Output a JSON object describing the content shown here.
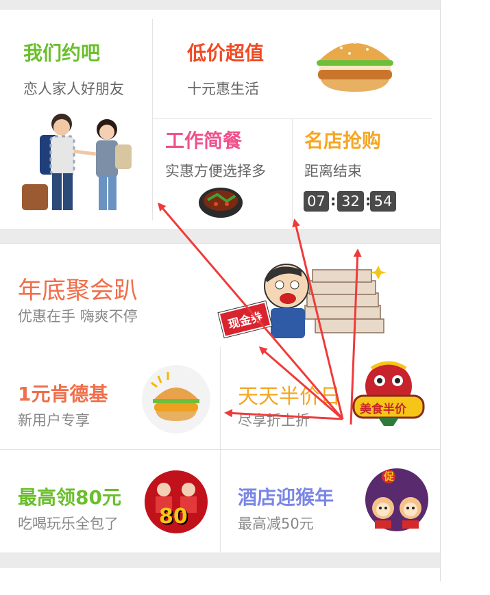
{
  "top": {
    "meet": {
      "title": "我们约吧",
      "subtitle": "恋人家人好朋友"
    },
    "cheap": {
      "title": "低价超值",
      "subtitle": "十元惠生活"
    },
    "lunch": {
      "title": "工作简餐",
      "subtitle": "实惠方便选择多"
    },
    "flash": {
      "title": "名店抢购",
      "subtitle": "距离结束",
      "countdown": [
        "07",
        "32",
        "54"
      ]
    }
  },
  "banner": {
    "title": "年底聚会趴",
    "subtitle": "优惠在手 嗨爽不停",
    "badge": "现金券"
  },
  "grid": [
    {
      "title": "1元肯德基",
      "subtitle": "新用户专享",
      "color": "#f06e4a"
    },
    {
      "title": "天天半价日",
      "subtitle": "尽享折上折",
      "color": "#f5a623",
      "badge": "美食半价"
    },
    {
      "title": "最高领80元",
      "subtitle": "吃喝玩乐全包了",
      "color": "#6abf2c",
      "badge": "80"
    },
    {
      "title": "酒店迎猴年",
      "subtitle": "最高减50元",
      "color": "#7a86e6",
      "badge": "促"
    }
  ],
  "colors": {
    "green": "#6abf2c",
    "red": "#f04a24",
    "pink": "#f0508c",
    "orange": "#f5a623",
    "coral": "#f06e4a",
    "arrow": "#f03a3a"
  }
}
